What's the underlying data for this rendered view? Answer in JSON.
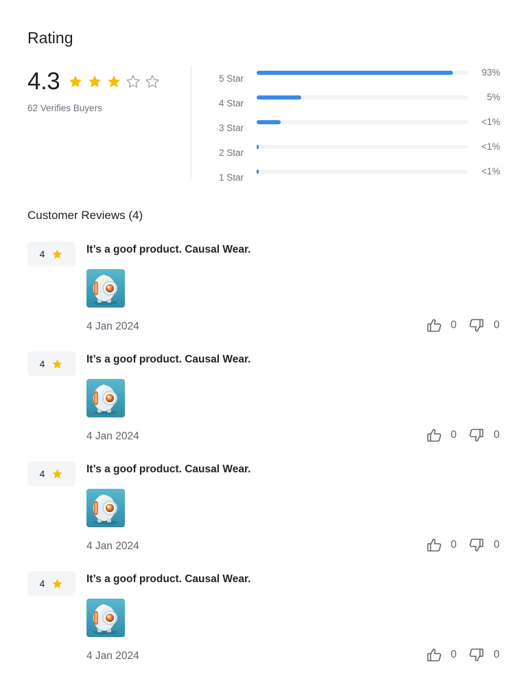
{
  "rating": {
    "title": "Rating",
    "average": "4.3",
    "stars_filled": 3,
    "stars_total": 5,
    "buyers_text": "62 Verifies Buyers",
    "star_color": "#F5BE0A",
    "empty_star_color": "#9aa0a8",
    "bar_color": "#3B8BEA",
    "distribution": [
      {
        "label": "5 Star",
        "percent_text": "93%",
        "fill": 0.93
      },
      {
        "label": "4 Star",
        "percent_text": "5%",
        "fill": 0.21
      },
      {
        "label": "3 Star",
        "percent_text": "<1%",
        "fill": 0.115
      },
      {
        "label": "2 Star",
        "percent_text": "<1%",
        "fill": 0.01
      },
      {
        "label": "1 Star",
        "percent_text": "<1%",
        "fill": 0.01
      }
    ]
  },
  "reviews": {
    "title": "Customer Reviews (4)",
    "items": [
      {
        "rating": "4",
        "text": "It’s a goof product. Causal Wear.",
        "date": "4 Jan 2024",
        "likes": "0",
        "dislikes": "0"
      },
      {
        "rating": "4",
        "text": "It’s a goof product. Causal Wear.",
        "date": "4 Jan 2024",
        "likes": "0",
        "dislikes": "0"
      },
      {
        "rating": "4",
        "text": "It’s a goof product. Causal Wear.",
        "date": "4 Jan 2024",
        "likes": "0",
        "dislikes": "0"
      },
      {
        "rating": "4",
        "text": "It’s a goof product. Causal Wear.",
        "date": "4 Jan 2024",
        "likes": "0",
        "dislikes": "0"
      }
    ],
    "icons": {
      "like": "thumbs-up-icon",
      "dislike": "thumbs-down-icon",
      "star": "star-icon",
      "image": "robot-product-image"
    }
  }
}
